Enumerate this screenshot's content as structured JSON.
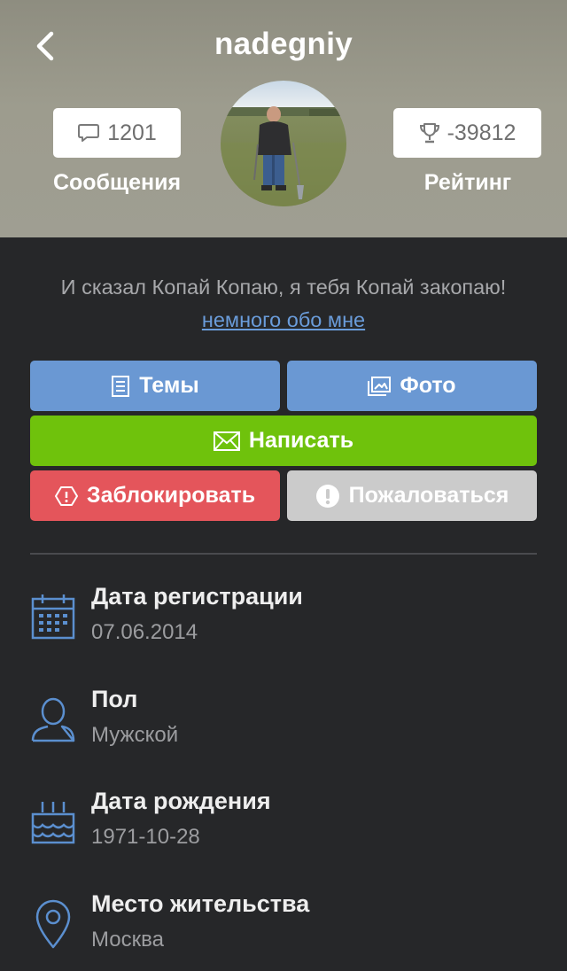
{
  "header": {
    "username": "nadegniy",
    "messages": {
      "count": "1201",
      "label": "Сообщения",
      "icon": "chat-bubble-icon"
    },
    "rating": {
      "value": "-39812",
      "label": "Рейтинг",
      "icon": "trophy-icon"
    }
  },
  "bio": {
    "text": "И сказал Копай Копаю, я тебя Копай закопаю!",
    "link": " немного обо мне"
  },
  "actions": {
    "topics": "Темы",
    "photo": "Фото",
    "write": "Написать",
    "block": "Заблокировать",
    "report": "Пожаловаться"
  },
  "info": [
    {
      "label": "Дата регистрации",
      "value": "07.06.2014",
      "icon": "calendar-icon"
    },
    {
      "label": "Пол",
      "value": "Мужской",
      "icon": "user-icon"
    },
    {
      "label": "Дата рождения",
      "value": "1971-10-28",
      "icon": "cake-icon"
    },
    {
      "label": "Место жительства",
      "value": "Москва",
      "icon": "location-pin-icon"
    }
  ],
  "colors": {
    "background": "#262729",
    "header": "#9d9c8e",
    "blue": "#6a98d3",
    "green": "#6fc20c",
    "red": "#e4555b",
    "gray": "#cbcbcb",
    "link": "#6a9cda",
    "icon": "#5b8fcf"
  }
}
